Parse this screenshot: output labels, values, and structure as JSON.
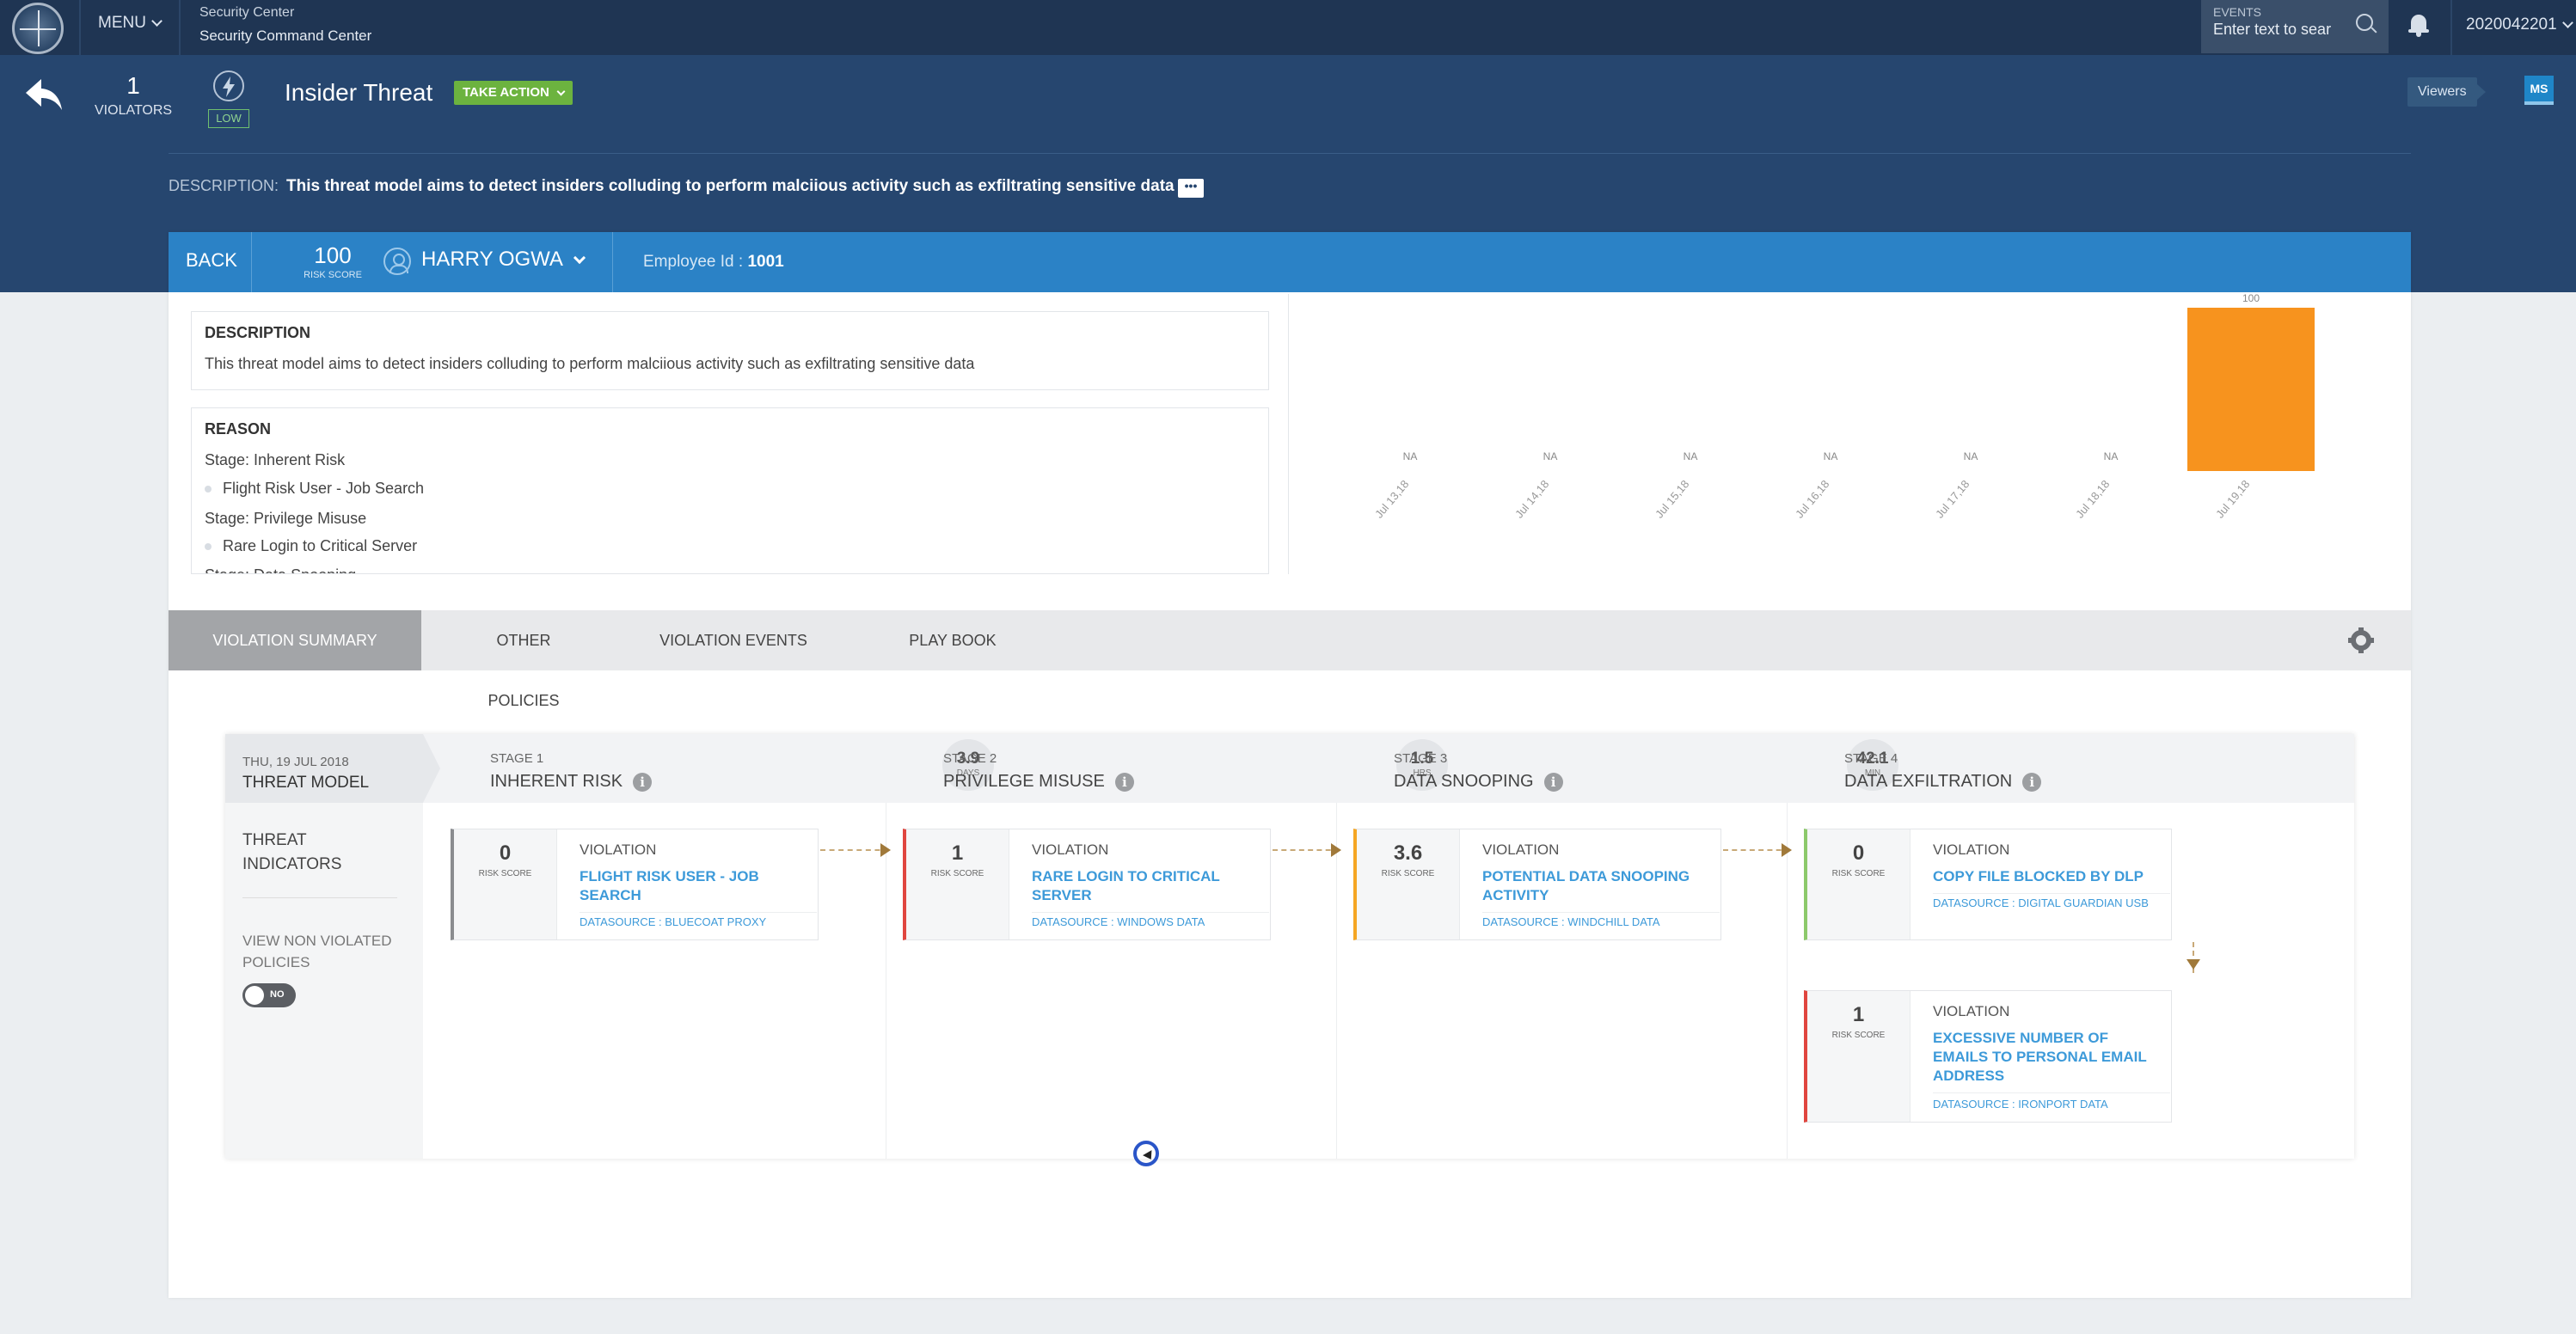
{
  "topbar": {
    "menu_label": "MENU",
    "app_line1": "Security Center",
    "app_line2": "Security Command Center",
    "events_label": "EVENTS",
    "events_placeholder": "Enter text to sear",
    "user_id": "2020042201"
  },
  "threat": {
    "violators_count": "1",
    "violators_label": "VIOLATORS",
    "severity": "LOW",
    "title": "Insider Threat",
    "take_action_label": "TAKE ACTION",
    "viewers_label": "Viewers",
    "avatar_initials": "MS",
    "description_label": "DESCRIPTION:",
    "description_text": "This threat model aims to detect insiders colluding to perform malciious activity such as exfiltrating sensitive data",
    "more_label": "•••"
  },
  "user_bar": {
    "back_label": "BACK",
    "risk_score": "100",
    "risk_score_label": "RISK SCORE",
    "user_name": "HARRY OGWA",
    "employee_label": "Employee Id :",
    "employee_id": "1001"
  },
  "description_panel": {
    "title": "DESCRIPTION",
    "text": "This threat model aims to detect insiders colluding to perform malciious activity such as exfiltrating sensitive data"
  },
  "reason_panel": {
    "title": "REASON",
    "stage1": "Stage: Inherent Risk",
    "item1": "Flight Risk User - Job Search",
    "stage2": "Stage: Privilege Misuse",
    "item2": "Rare Login to Critical Server",
    "stage3_partial": "Stage: Data Snooping"
  },
  "chart_data": {
    "type": "bar",
    "categories": [
      "Jul 13,18",
      "Jul 14,18",
      "Jul 15,18",
      "Jul 16,18",
      "Jul 17,18",
      "Jul 18,18",
      "Jul 19,18"
    ],
    "values": [
      null,
      null,
      null,
      null,
      null,
      null,
      100
    ],
    "value_labels": [
      "NA",
      "NA",
      "NA",
      "NA",
      "NA",
      "NA",
      "100"
    ],
    "ylim": [
      0,
      100
    ],
    "color": "#f7931e"
  },
  "tabs": [
    {
      "label": "VIOLATION SUMMARY",
      "active": true
    },
    {
      "label": "OTHER POLICIES",
      "active": false
    },
    {
      "label": "VIOLATION EVENTS",
      "active": false
    },
    {
      "label": "PLAY BOOK",
      "active": false
    }
  ],
  "flow": {
    "date": "THU, 19 JUL 2018",
    "model_label": "THREAT MODEL",
    "threat_indicators": "THREAT INDICATORS",
    "view_non_violated": "VIEW NON VIOLATED POLICIES",
    "toggle_label": "NO",
    "stages": [
      {
        "number": "STAGE 1",
        "name": "INHERENT RISK"
      },
      {
        "number": "STAGE 2",
        "name": "PRIVILEGE MISUSE"
      },
      {
        "number": "STAGE 3",
        "name": "DATA SNOOPING"
      },
      {
        "number": "STAGE 4",
        "name": "DATA EXFILTRATION"
      }
    ],
    "durations": [
      {
        "value": "3.9",
        "unit": "DAYS"
      },
      {
        "value": "1.5",
        "unit": "HRS"
      },
      {
        "value": "42.1",
        "unit": "MIN"
      }
    ],
    "violations": [
      {
        "score": "0",
        "score_label": "RISK SCORE",
        "label": "VIOLATION",
        "title": "FLIGHT RISK USER - JOB SEARCH",
        "datasource": "DATASOURCE : BLUECOAT PROXY",
        "color": "#8a8c8f"
      },
      {
        "score": "1",
        "score_label": "RISK SCORE",
        "label": "VIOLATION",
        "title": "RARE LOGIN TO CRITICAL SERVER",
        "datasource": "DATASOURCE : WINDOWS DATA",
        "color": "#e0463f"
      },
      {
        "score": "3.6",
        "score_label": "RISK SCORE",
        "label": "VIOLATION",
        "title": "POTENTIAL DATA SNOOPING ACTIVITY",
        "datasource": "DATASOURCE : WINDCHILL DATA",
        "color": "#f5a623"
      },
      {
        "score": "0",
        "score_label": "RISK SCORE",
        "label": "VIOLATION",
        "title": "COPY FILE BLOCKED BY DLP",
        "datasource": "DATASOURCE : DIGITAL GUARDIAN USB",
        "color": "#8cc96b"
      },
      {
        "score": "1",
        "score_label": "RISK SCORE",
        "label": "VIOLATION",
        "title": "EXCESSIVE NUMBER OF EMAILS TO PERSONAL EMAIL ADDRESS",
        "datasource": "DATASOURCE : IRONPORT DATA",
        "color": "#e0463f"
      }
    ]
  }
}
